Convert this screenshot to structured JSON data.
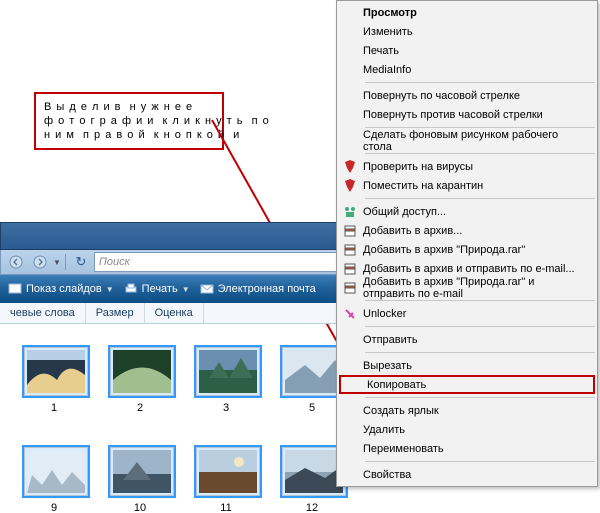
{
  "annotation": {
    "line1": "В ы д е л и в  н у ж н е е",
    "line2": "ф о т о г р а ф и и  к л и к н у т ь  п о",
    "line3": "н и м  п р а в о й  к н о п к о й  и"
  },
  "explorer": {
    "search_placeholder": "Поиск",
    "toolbar": {
      "slides": "Показ слайдов",
      "print": "Печать",
      "email": "Электронная почта"
    },
    "columns": {
      "keywords": "чевые слова",
      "size": "Размер",
      "rating": "Оценка"
    },
    "thumbs": {
      "r1": [
        "1",
        "2",
        "3",
        "5"
      ],
      "r2": [
        "9",
        "10",
        "11",
        "12"
      ]
    }
  },
  "context_menu": {
    "view": "Просмотр",
    "edit": "Изменить",
    "print": "Печать",
    "mediainfo": "MediaInfo",
    "rotate_cw": "Повернуть по часовой стрелке",
    "rotate_ccw": "Повернуть против часовой стрелки",
    "wallpaper": "Сделать фоновым рисунком рабочего стола",
    "virus_check": "Проверить на вирусы",
    "quarantine": "Поместить на карантин",
    "share": "Общий доступ...",
    "add_archive": "Добавить в архив...",
    "add_archive_name": "Добавить в архив \"Природа.rar\"",
    "add_archive_email": "Добавить в архив и отправить по e-mail...",
    "add_archive_name_email": "Добавить в архив \"Природа.rar\" и отправить по e-mail",
    "unlocker": "Unlocker",
    "send": "Отправить",
    "cut": "Вырезать",
    "copy": "Копировать",
    "shortcut": "Создать ярлык",
    "delete": "Удалить",
    "rename": "Переименовать",
    "properties": "Свойства"
  }
}
